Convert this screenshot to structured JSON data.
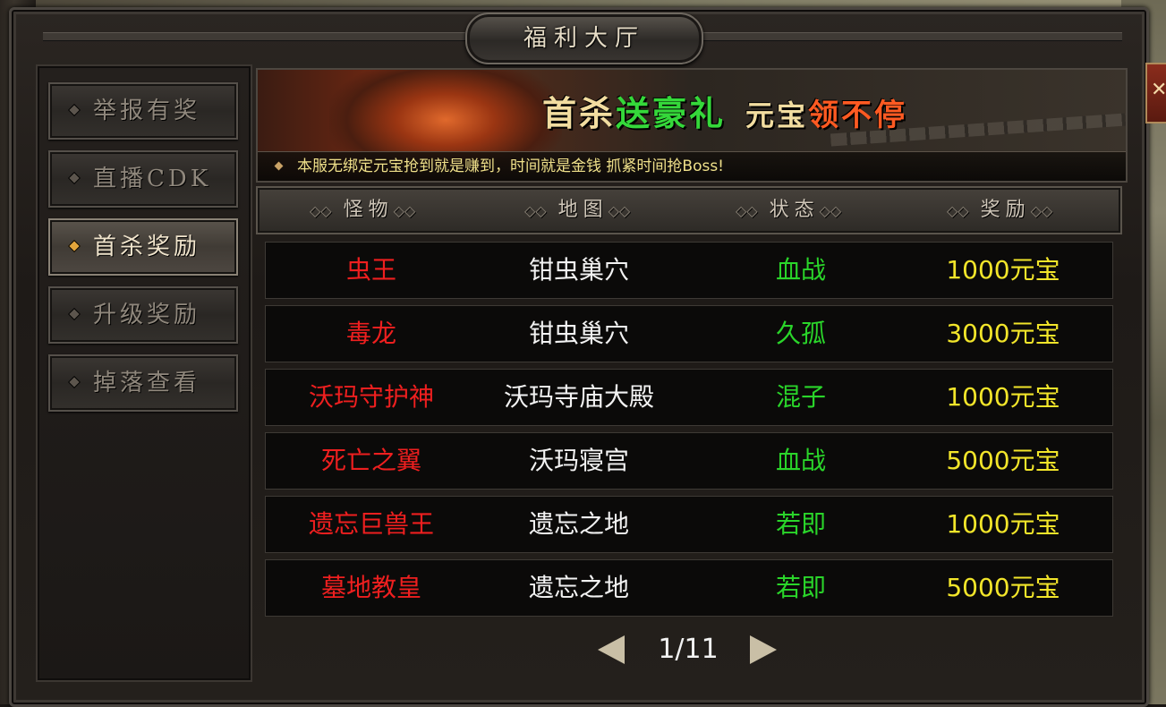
{
  "window": {
    "title": "福利大厅"
  },
  "sidebar": {
    "items": [
      {
        "label": "举报有奖",
        "active": false
      },
      {
        "label": "直播CDK",
        "active": false
      },
      {
        "label": "首杀奖励",
        "active": true
      },
      {
        "label": "升级奖励",
        "active": false
      },
      {
        "label": "掉落查看",
        "active": false
      }
    ]
  },
  "banner": {
    "headline_part1": "首杀",
    "headline_part2": "送豪礼",
    "headline_part3": "元宝",
    "headline_part4": "领不停",
    "ticker": "本服无绑定元宝抢到就是赚到，时间就是金钱 抓紧时间抢Boss!"
  },
  "table": {
    "headers": [
      "怪物",
      "地图",
      "状态",
      "奖励"
    ],
    "rows": [
      {
        "monster": "虫王",
        "map": "钳虫巢穴",
        "status": "血战",
        "reward": "1000元宝"
      },
      {
        "monster": "毒龙",
        "map": "钳虫巢穴",
        "status": "久孤",
        "reward": "3000元宝"
      },
      {
        "monster": "沃玛守护神",
        "map": "沃玛寺庙大殿",
        "status": "混子",
        "reward": "1000元宝"
      },
      {
        "monster": "死亡之翼",
        "map": "沃玛寝宫",
        "status": "血战",
        "reward": "5000元宝"
      },
      {
        "monster": "遗忘巨兽王",
        "map": "遗忘之地",
        "status": "若即",
        "reward": "1000元宝"
      },
      {
        "monster": "墓地教皇",
        "map": "遗忘之地",
        "status": "若即",
        "reward": "5000元宝"
      }
    ]
  },
  "pager": {
    "text": "1/11"
  },
  "colors": {
    "monster": "#ee1f1f",
    "map": "#f2f2f2",
    "status": "#2ad52a",
    "reward": "#f2e52a"
  },
  "icons": {
    "prev": "chevron-left-icon",
    "next": "chevron-right-icon",
    "close": "close-icon"
  }
}
